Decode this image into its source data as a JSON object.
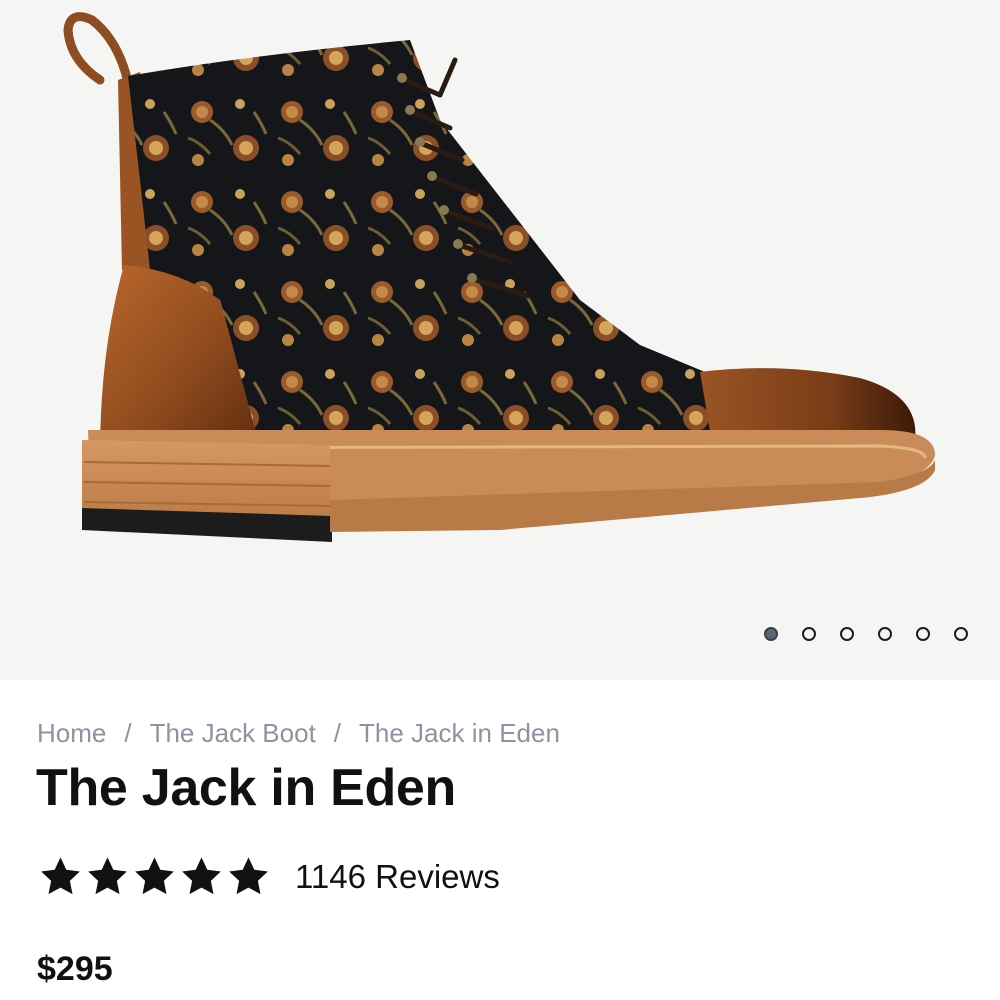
{
  "product": {
    "image_description_icon": "boot-product-image",
    "slides": {
      "count": 6,
      "active_index": 0
    }
  },
  "breadcrumb": {
    "items": [
      "Home",
      "The Jack Boot",
      "The Jack in Eden"
    ],
    "separator": "/"
  },
  "title": "The Jack in Eden",
  "rating": {
    "stars": 5,
    "reviews_text": "1146 Reviews"
  },
  "price": "$295",
  "colors": {
    "breadcrumb": "#8d93a0",
    "text": "#111111",
    "gallery_bg": "#f5f5f4",
    "active_dot": "#5d6575"
  }
}
